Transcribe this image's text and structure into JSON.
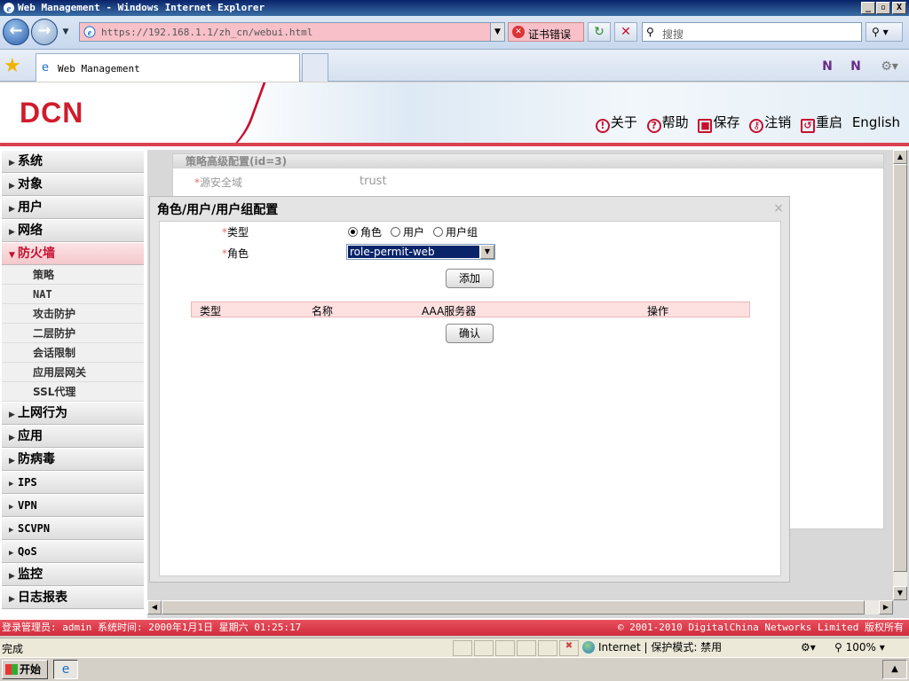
{
  "window": {
    "title": "Web Management - Windows Internet Explorer",
    "minimize": "_",
    "maximize": "▫",
    "close": "X"
  },
  "navbar": {
    "url": "https://192.168.1.1/zh_cn/webui.html",
    "cert_error": "证书错误",
    "search_placeholder": "搜搜"
  },
  "tab": {
    "title": "Web Management"
  },
  "header": {
    "logo": "DCN",
    "links": [
      {
        "icon": "!",
        "label": "关于"
      },
      {
        "icon": "?",
        "label": "帮助"
      },
      {
        "icon": "■",
        "label": "保存"
      },
      {
        "icon": "⚷",
        "label": "注销"
      },
      {
        "icon": "↺",
        "label": "重启"
      },
      {
        "label": "English"
      }
    ]
  },
  "sidebar": {
    "items": [
      {
        "label": "系统"
      },
      {
        "label": "对象"
      },
      {
        "label": "用户"
      },
      {
        "label": "网络"
      },
      {
        "label": "防火墙",
        "expanded": true,
        "children": [
          "策略",
          "NAT",
          "攻击防护",
          "二层防护",
          "会话限制",
          "应用层网关",
          "SSL代理"
        ]
      },
      {
        "label": "上网行为"
      },
      {
        "label": "应用"
      },
      {
        "label": "防病毒"
      },
      {
        "label": "IPS"
      },
      {
        "label": "VPN"
      },
      {
        "label": "SCVPN"
      },
      {
        "label": "QoS"
      },
      {
        "label": "监控"
      },
      {
        "label": "日志报表"
      }
    ]
  },
  "background_panel": {
    "title": "策略高级配置(id=3)",
    "field_label": "源安全域",
    "field_value": "trust"
  },
  "dialog": {
    "title": "角色/用户/用户组配置",
    "close": "×",
    "type_label": "类型",
    "type_options": [
      "角色",
      "用户",
      "用户组"
    ],
    "type_selected": "角色",
    "role_label": "角色",
    "role_value": "role-permit-web",
    "add_button": "添加",
    "table_headers": [
      "类型",
      "名称",
      "AAA服务器",
      "操作"
    ],
    "confirm_button": "确认",
    "required_mark": "*"
  },
  "footer": {
    "left": "登录管理员: admin 系统时间: 2000年1月1日 星期六 01:25:17",
    "right": "© 2001-2010 DigitalChina Networks Limited 版权所有"
  },
  "statusbar": {
    "status": "完成",
    "zone": "Internet | 保护模式: 禁用",
    "zoom": "100%"
  },
  "taskbar": {
    "start": "开始"
  }
}
